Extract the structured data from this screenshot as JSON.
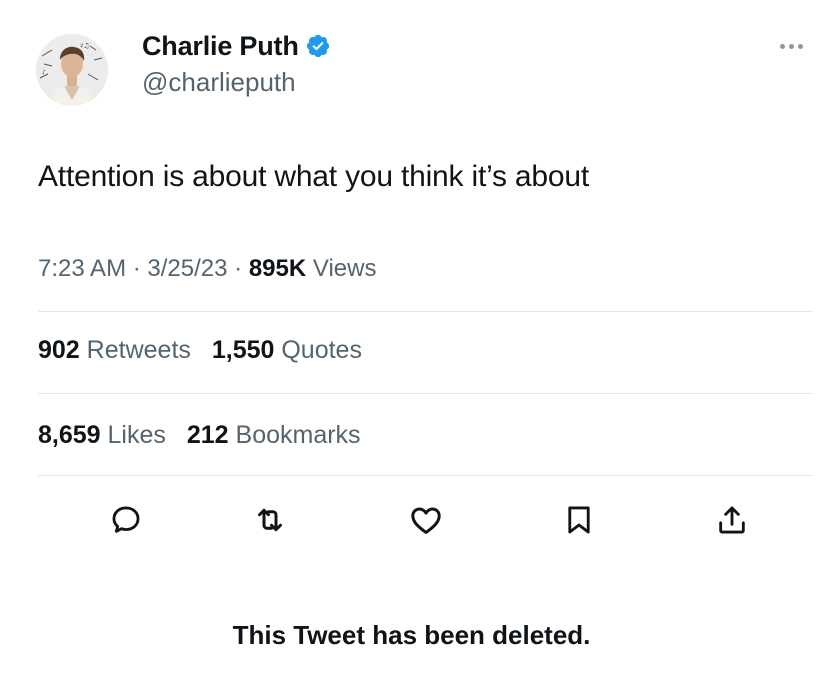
{
  "author": {
    "display_name": "Charlie Puth",
    "handle": "@charlieputh",
    "verified": true,
    "verified_color": "#1d9bf0"
  },
  "tweet": {
    "text": "Attention is about what you think it’s about",
    "time": "7:23 AM",
    "separator": "·",
    "date": "3/25/23",
    "views_count": "895K",
    "views_label": "Views"
  },
  "stats": {
    "retweets_count": "902",
    "retweets_label": "Retweets",
    "quotes_count": "1,550",
    "quotes_label": "Quotes",
    "likes_count": "8,659",
    "likes_label": "Likes",
    "bookmarks_count": "212",
    "bookmarks_label": "Bookmarks"
  },
  "actions": {
    "icons": [
      "reply-icon",
      "retweet-icon",
      "like-icon",
      "bookmark-icon",
      "share-icon"
    ]
  },
  "status_message": "This Tweet has been deleted.",
  "colors": {
    "text_primary": "#0f1419",
    "text_secondary": "#536471",
    "divider": "#e3e7ea"
  }
}
